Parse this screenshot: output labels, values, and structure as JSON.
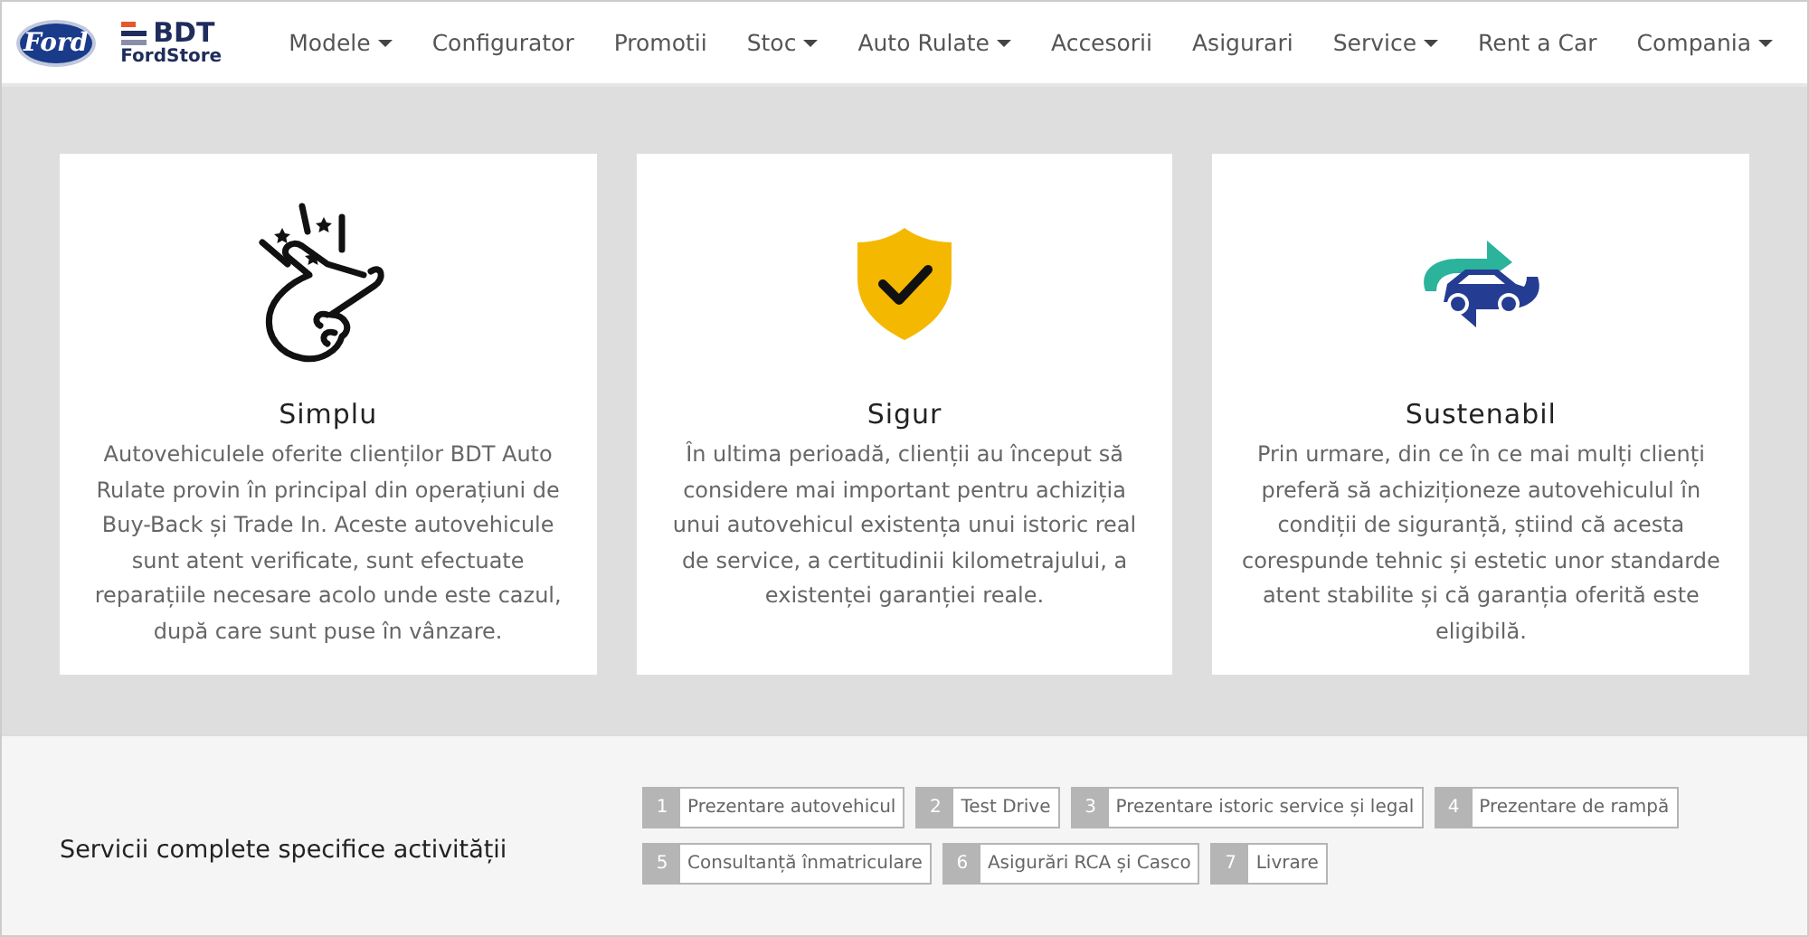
{
  "header": {
    "brand_logo": "Ford",
    "store_name": "BDT",
    "store_sub": "FordStore",
    "nav": [
      {
        "label": "Modele",
        "has_menu": true
      },
      {
        "label": "Configurator",
        "has_menu": false
      },
      {
        "label": "Promotii",
        "has_menu": false
      },
      {
        "label": "Stoc",
        "has_menu": true
      },
      {
        "label": "Auto Rulate",
        "has_menu": true
      },
      {
        "label": "Accesorii",
        "has_menu": false
      },
      {
        "label": "Asigurari",
        "has_menu": false
      },
      {
        "label": "Service",
        "has_menu": true
      },
      {
        "label": "Rent a Car",
        "has_menu": false
      },
      {
        "label": "Compania",
        "has_menu": true
      }
    ]
  },
  "features": [
    {
      "kind": "snap",
      "title": "Simplu",
      "text": "Autovehiculele oferite clienților BDT Auto Rulate provin în principal din operațiuni de Buy-Back și Trade In. Aceste autovehicule sunt atent verificate, sunt efectuate reparațiile necesare acolo unde este cazul, după care sunt puse în vânzare."
    },
    {
      "kind": "shield",
      "title": "Sigur",
      "text": "În ultima perioadă, clienții au început să considere mai important pentru achiziția unui autovehicul existența unui istoric real de service, a certitudinii kilometrajului, a existenței garanției reale."
    },
    {
      "kind": "cycle",
      "title": "Sustenabil",
      "text": "Prin urmare, din ce în ce mai mulți clienți preferă să achiziționeze autovehiculul în condiții de siguranță, știind că acesta corespunde tehnic și estetic unor standarde atent stabilite și că garanția oferită este eligibilă."
    }
  ],
  "services": {
    "title": "Servicii complete specifice activității",
    "steps": [
      {
        "number": "1",
        "label": "Prezentare autovehicul"
      },
      {
        "number": "2",
        "label": "Test Drive"
      },
      {
        "number": "3",
        "label": "Prezentare istoric service și legal"
      },
      {
        "number": "4",
        "label": "Prezentare de rampă"
      },
      {
        "number": "5",
        "label": "Consultanță înmatriculare"
      },
      {
        "number": "6",
        "label": "Asigurări RCA și Casco"
      },
      {
        "number": "7",
        "label": "Livrare"
      }
    ]
  }
}
